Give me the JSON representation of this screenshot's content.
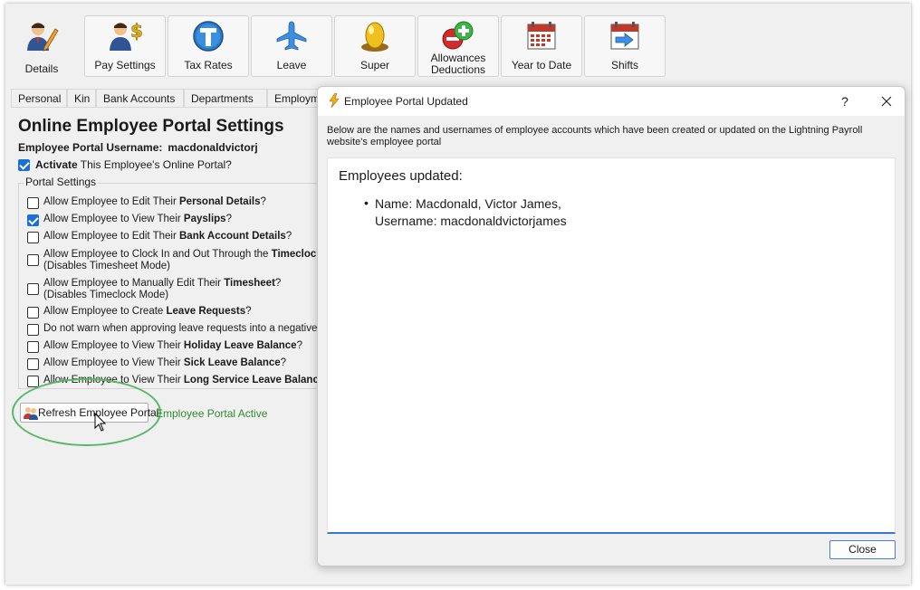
{
  "toolbar": {
    "details": "Details",
    "pay_settings": "Pay Settings",
    "tax_rates": "Tax Rates",
    "leave": "Leave",
    "super": "Super",
    "allowances_line1": "Allowances",
    "allowances_line2": "Deductions",
    "year_to_date": "Year to Date",
    "shifts": "Shifts"
  },
  "tabs": [
    "Personal",
    "Kin",
    "Bank Accounts",
    "Departments",
    "Employme"
  ],
  "portal": {
    "title": "Online Employee Portal Settings",
    "username_label": "Employee Portal Username:",
    "username_value": "macdonaldvictorj",
    "activate_bold": "Activate",
    "activate_rest": " This Employee's Online Portal?",
    "activate_checked": true,
    "group_label": "Portal Settings",
    "options": [
      {
        "pre": "Allow Employee to Edit Their ",
        "bold": "Personal Details",
        "post": "?",
        "line2": "",
        "checked": false
      },
      {
        "pre": "Allow Employee to View Their ",
        "bold": "Payslips",
        "post": "?",
        "line2": "",
        "checked": true
      },
      {
        "pre": "Allow Employee to Edit Their ",
        "bold": "Bank Account Details",
        "post": "?",
        "line2": "",
        "checked": false
      },
      {
        "pre": "Allow Employee to Clock In and Out Through the ",
        "bold": "Timeclock",
        "post": "?",
        "line2": "(Disables Timesheet Mode)",
        "checked": false
      },
      {
        "pre": "Allow Employee to Manually Edit Their ",
        "bold": "Timesheet",
        "post": "?",
        "line2": "(Disables Timeclock Mode)",
        "checked": false
      },
      {
        "pre": "Allow Employee to Create ",
        "bold": "Leave Requests",
        "post": "?",
        "line2": "",
        "checked": false
      },
      {
        "pre": "Do not warn when approving leave requests into a negative ba",
        "bold": "",
        "post": "",
        "line2": "",
        "checked": false
      },
      {
        "pre": "Allow Employee to View Their ",
        "bold": "Holiday Leave Balance",
        "post": "?",
        "line2": "",
        "checked": false
      },
      {
        "pre": "Allow Employee to View Their ",
        "bold": "Sick Leave Balance",
        "post": "?",
        "line2": "",
        "checked": false
      },
      {
        "pre": "Allow Employee to View Their ",
        "bold": "Long Service Leave Balance",
        "post": "?",
        "line2": "",
        "checked": false
      }
    ],
    "refresh_button": "Refresh Employee Portal",
    "status": "Employee Portal Active"
  },
  "dialog": {
    "title": "Employee Portal Updated",
    "help": "?",
    "description": "Below are the names and usernames of employee accounts which have been created or updated on the Lightning Payroll website's employee portal",
    "heading": "Employees updated:",
    "name_line": "Name: Macdonald, Victor James,",
    "username_line": "Username: macdonaldvictorjames",
    "close_button": "Close"
  },
  "colors": {
    "accent": "#1b6fd6",
    "status_green": "#2e8b2e",
    "highlight_ellipse": "#58b86a"
  }
}
